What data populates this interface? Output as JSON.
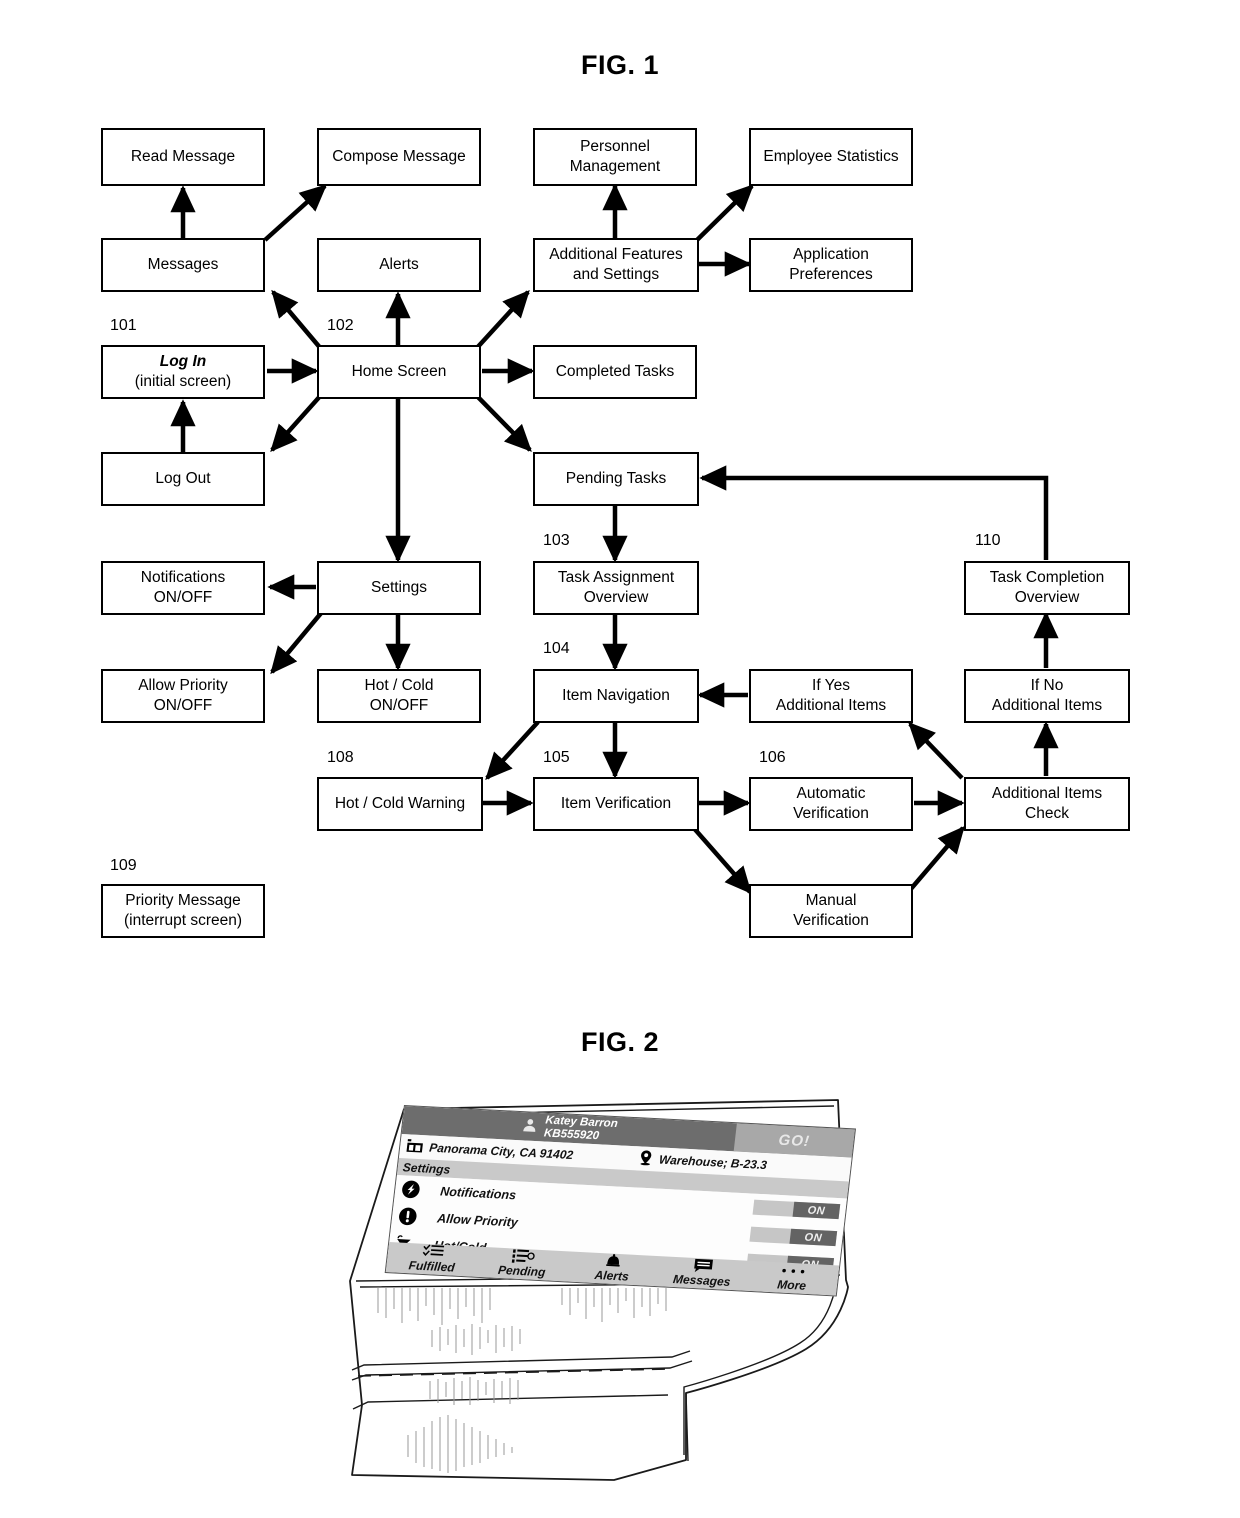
{
  "figures": {
    "fig1_title": "FIG. 1",
    "fig2_title": "FIG. 2"
  },
  "flowchart": {
    "nodes": [
      {
        "id": "read_message",
        "lines": [
          "Read Message"
        ]
      },
      {
        "id": "compose_message",
        "lines": [
          "Compose Message"
        ]
      },
      {
        "id": "personnel",
        "lines": [
          "Personnel",
          "Management"
        ]
      },
      {
        "id": "employee_stats",
        "lines": [
          "Employee Statistics"
        ]
      },
      {
        "id": "messages",
        "lines": [
          "Messages"
        ]
      },
      {
        "id": "alerts",
        "lines": [
          "Alerts"
        ]
      },
      {
        "id": "additional",
        "lines": [
          "Additional Features",
          "and Settings"
        ]
      },
      {
        "id": "app_prefs",
        "lines": [
          "Application",
          "Preferences"
        ]
      },
      {
        "id": "login",
        "lines": [
          "Log In",
          "(initial screen)"
        ],
        "bold_first": true
      },
      {
        "id": "home",
        "lines": [
          "Home Screen"
        ]
      },
      {
        "id": "completed",
        "lines": [
          "Completed Tasks"
        ]
      },
      {
        "id": "logout",
        "lines": [
          "Log Out"
        ]
      },
      {
        "id": "pending",
        "lines": [
          "Pending Tasks"
        ]
      },
      {
        "id": "notifications",
        "lines": [
          "Notifications",
          "ON/OFF"
        ]
      },
      {
        "id": "settings",
        "lines": [
          "Settings"
        ]
      },
      {
        "id": "task_assign",
        "lines": [
          "Task Assignment",
          "Overview"
        ]
      },
      {
        "id": "task_complete",
        "lines": [
          "Task Completion",
          "Overview"
        ]
      },
      {
        "id": "allow_priority",
        "lines": [
          "Allow Priority",
          "ON/OFF"
        ]
      },
      {
        "id": "hot_cold",
        "lines": [
          "Hot / Cold",
          "ON/OFF"
        ]
      },
      {
        "id": "item_nav",
        "lines": [
          "Item Navigation"
        ]
      },
      {
        "id": "if_yes",
        "lines": [
          "If Yes",
          "Additional Items"
        ]
      },
      {
        "id": "if_no",
        "lines": [
          "If No",
          "Additional Items"
        ]
      },
      {
        "id": "hot_cold_warn",
        "lines": [
          "Hot / Cold Warning"
        ]
      },
      {
        "id": "item_verif",
        "lines": [
          "Item Verification"
        ]
      },
      {
        "id": "auto_verif",
        "lines": [
          "Automatic",
          "Verification"
        ]
      },
      {
        "id": "addl_check",
        "lines": [
          "Additional Items",
          "Check"
        ]
      },
      {
        "id": "manual_verif",
        "lines": [
          "Manual",
          "Verification"
        ]
      },
      {
        "id": "priority_msg",
        "lines": [
          "Priority Message",
          "(interrupt screen)"
        ]
      }
    ],
    "reference_numerals": [
      "101",
      "102",
      "103",
      "104",
      "105",
      "106",
      "108",
      "109",
      "110"
    ]
  },
  "device": {
    "topbar": {
      "user_name": "Katey Barron",
      "user_id": "KB555920",
      "go_label": "GO!",
      "avatar_icon": "person-icon"
    },
    "location_bar": {
      "city": "Panorama City, CA 91402",
      "warehouse": "Warehouse; B-23.3",
      "city_icon": "building-icon",
      "warehouse_icon": "map-pin-icon"
    },
    "section_header": "Settings",
    "settings_rows": [
      {
        "label": "Notifications",
        "icon": "bolt-icon",
        "toggle": "ON"
      },
      {
        "label": "Allow Priority",
        "icon": "exclamation-icon",
        "toggle": "ON"
      },
      {
        "label": "Hot/Cold",
        "icon": "thermometer-icon",
        "toggle": "ON"
      }
    ],
    "nav_items": [
      {
        "label": "Fulfilled",
        "icon": "checklist-icon"
      },
      {
        "label": "Pending",
        "icon": "list-clock-icon"
      },
      {
        "label": "Alerts",
        "icon": "bell-icon"
      },
      {
        "label": "Messages",
        "icon": "message-icon"
      },
      {
        "label": "More",
        "icon": "ellipsis-icon"
      }
    ]
  }
}
